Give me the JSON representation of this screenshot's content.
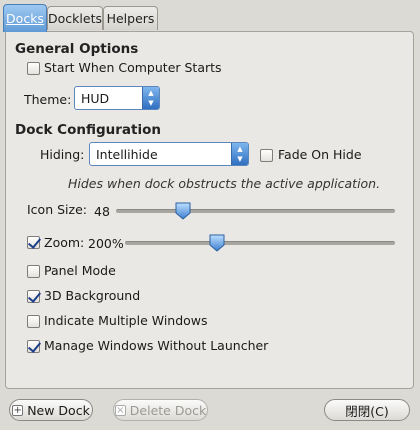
{
  "tabs": [
    {
      "label": "Docks",
      "active": true
    },
    {
      "label": "Docklets",
      "active": false
    },
    {
      "label": "Helpers",
      "active": false
    }
  ],
  "general": {
    "heading": "General Options",
    "start_checkbox": {
      "label": "Start When Computer Starts",
      "checked": false
    },
    "theme_label": "Theme:",
    "theme_value": "HUD"
  },
  "dock": {
    "heading": "Dock Configuration",
    "hiding_label": "Hiding:",
    "hiding_value": "Intellihide",
    "fade_checkbox": {
      "label": "Fade On Hide",
      "checked": false
    },
    "hiding_description": "Hides when dock obstructs the active application.",
    "icon_size_label": "Icon Size:",
    "icon_size_value": "48",
    "zoom_label": "Zoom:",
    "zoom_checked": true,
    "zoom_value": "200%",
    "panel_mode": {
      "label": "Panel Mode",
      "checked": false
    },
    "bg_3d": {
      "label": "3D Background",
      "checked": true
    },
    "multi_windows": {
      "label": "Indicate Multiple Windows",
      "checked": false
    },
    "manage_windows": {
      "label": "Manage Windows Without Launcher",
      "checked": true
    }
  },
  "footer": {
    "new_dock": "New Dock",
    "delete_dock": "Delete Dock",
    "close": "閉閉(C)"
  },
  "colors": {
    "accent": "#4a86c8",
    "check": "#1e3f8a"
  }
}
